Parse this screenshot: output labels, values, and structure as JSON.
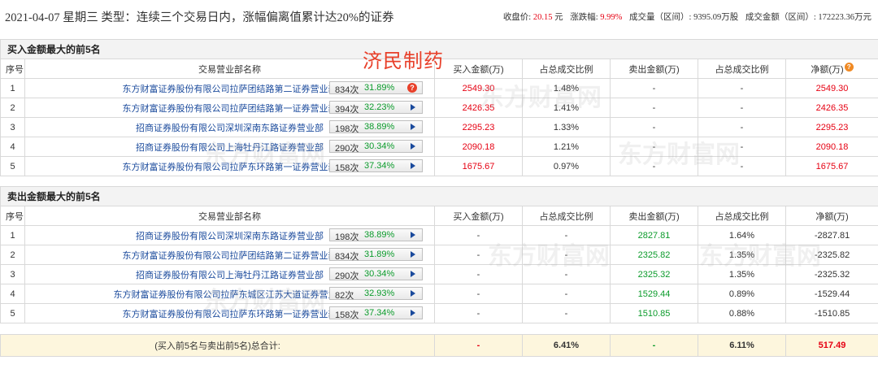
{
  "header": {
    "date_type": "2021-04-07 星期三  类型：连续三个交易日内，涨幅偏离值累计达20%的证券",
    "close_label": "收盘价:",
    "close_value": "20.15",
    "close_unit": "元",
    "change_label": "涨跌幅:",
    "change_value": "9.99%",
    "volume_label": "成交量（区间）:",
    "volume_value": "9395.09万股",
    "amount_label": "成交金额（区间）:",
    "amount_value": "172223.36万元"
  },
  "overlay_title": "济民制药",
  "watermark": "东方财富网",
  "columns": {
    "seq": "序号",
    "name": "交易营业部名称",
    "buy": "买入金额(万)",
    "buy_ratio": "占总成交比例",
    "sell": "卖出金额(万)",
    "sell_ratio": "占总成交比例",
    "net": "净额(万)"
  },
  "buy_section": {
    "title": "买入金额最大的前5名",
    "rows": [
      {
        "seq": "1",
        "name": "东方财富证券股份有限公司拉萨团结路第二证券营业部",
        "count": "834次",
        "rate": "31.89%",
        "buy": "2549.30",
        "buy_ratio": "1.48%",
        "sell": "-",
        "sell_ratio": "-",
        "net": "2549.30"
      },
      {
        "seq": "2",
        "name": "东方财富证券股份有限公司拉萨团结路第一证券营业部",
        "count": "394次",
        "rate": "32.23%",
        "buy": "2426.35",
        "buy_ratio": "1.41%",
        "sell": "-",
        "sell_ratio": "-",
        "net": "2426.35"
      },
      {
        "seq": "3",
        "name": "招商证券股份有限公司深圳深南东路证券营业部",
        "count": "198次",
        "rate": "38.89%",
        "buy": "2295.23",
        "buy_ratio": "1.33%",
        "sell": "-",
        "sell_ratio": "-",
        "net": "2295.23"
      },
      {
        "seq": "4",
        "name": "招商证券股份有限公司上海牡丹江路证券营业部",
        "count": "290次",
        "rate": "30.34%",
        "buy": "2090.18",
        "buy_ratio": "1.21%",
        "sell": "-",
        "sell_ratio": "-",
        "net": "2090.18"
      },
      {
        "seq": "5",
        "name": "东方财富证券股份有限公司拉萨东环路第一证券营业部",
        "count": "158次",
        "rate": "37.34%",
        "buy": "1675.67",
        "buy_ratio": "0.97%",
        "sell": "-",
        "sell_ratio": "-",
        "net": "1675.67"
      }
    ]
  },
  "sell_section": {
    "title": "卖出金额最大的前5名",
    "rows": [
      {
        "seq": "1",
        "name": "招商证券股份有限公司深圳深南东路证券营业部",
        "count": "198次",
        "rate": "38.89%",
        "buy": "-",
        "buy_ratio": "-",
        "sell": "2827.81",
        "sell_ratio": "1.64%",
        "net": "-2827.81"
      },
      {
        "seq": "2",
        "name": "东方财富证券股份有限公司拉萨团结路第二证券营业部",
        "count": "834次",
        "rate": "31.89%",
        "buy": "-",
        "buy_ratio": "-",
        "sell": "2325.82",
        "sell_ratio": "1.35%",
        "net": "-2325.82"
      },
      {
        "seq": "3",
        "name": "招商证券股份有限公司上海牡丹江路证券营业部",
        "count": "290次",
        "rate": "30.34%",
        "buy": "-",
        "buy_ratio": "-",
        "sell": "2325.32",
        "sell_ratio": "1.35%",
        "net": "-2325.32"
      },
      {
        "seq": "4",
        "name": "东方财富证券股份有限公司拉萨东城区江苏大道证券营业部",
        "count": "82次",
        "rate": "32.93%",
        "buy": "-",
        "buy_ratio": "-",
        "sell": "1529.44",
        "sell_ratio": "0.89%",
        "net": "-1529.44"
      },
      {
        "seq": "5",
        "name": "东方财富证券股份有限公司拉萨东环路第一证券营业部",
        "count": "158次",
        "rate": "37.34%",
        "buy": "-",
        "buy_ratio": "-",
        "sell": "1510.85",
        "sell_ratio": "0.88%",
        "net": "-1510.85"
      }
    ]
  },
  "total": {
    "label": "(买入前5名与卖出前5名)总合计:",
    "buy": "-",
    "buy_ratio": "6.41%",
    "sell": "-",
    "sell_ratio": "6.11%",
    "net": "517.49"
  },
  "colors": {
    "red": "#e60012",
    "green": "#0b9b2b",
    "link": "#1a4a9c",
    "overlay": "#e8402a"
  }
}
